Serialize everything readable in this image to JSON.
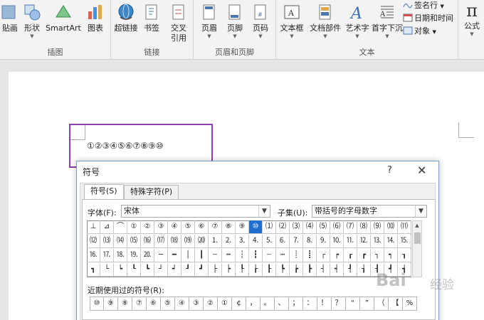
{
  "ribbon": {
    "groups": {
      "illustrations": {
        "label": "插图",
        "buttons": [
          "贴画",
          "形状",
          "SmartArt",
          "图表"
        ]
      },
      "links": {
        "label": "链接",
        "buttons": [
          "超链接",
          "书签",
          "交叉",
          "引用"
        ]
      },
      "header_footer": {
        "label": "页眉和页脚",
        "buttons": [
          "页眉",
          "页脚",
          "页码"
        ]
      },
      "text": {
        "label": "文本",
        "buttons": [
          "文本框",
          "文档部件",
          "艺术字",
          "首字下沉"
        ],
        "small": [
          "签名行",
          "日期和时间",
          "对象"
        ]
      },
      "symbols": {
        "buttons": [
          "公式"
        ],
        "pi": "π"
      }
    }
  },
  "document": {
    "text": "①②③④⑤⑥⑦⑧⑨⑩"
  },
  "dialog": {
    "title": "符号",
    "help": "?",
    "close": "✕",
    "tabs": [
      "符号(S)",
      "特殊字符(P)"
    ],
    "font_label": "字体(F):",
    "font_value": "宋体",
    "subset_label": "子集(U):",
    "subset_value": "带括号的字母数字",
    "symbol_rows": [
      [
        "⊥",
        "⊿",
        "⌒",
        "①",
        "②",
        "③",
        "④",
        "⑤",
        "⑥",
        "⑦",
        "⑧",
        "⑨",
        "⑩",
        "⑴",
        "⑵",
        "⑶",
        "⑷",
        "⑸",
        "⑹",
        "⑺",
        "⑻",
        "⑼",
        "⑽",
        "⑾"
      ],
      [
        "⑿",
        "⒀",
        "⒁",
        "⒂",
        "⒃",
        "⒄",
        "⒅",
        "⒆",
        "⒇",
        "⒈",
        "⒉",
        "⒊",
        "⒋",
        "⒌",
        "⒍",
        "⒎",
        "⒏",
        "⒐",
        "⒑",
        "⒒",
        "⒓",
        "⒔",
        "⒕",
        "⒖"
      ],
      [
        "⒗",
        "⒘",
        "⒙",
        "⒚",
        "⒛",
        "─",
        "━",
        "│",
        "┃",
        "┄",
        "┅",
        "┆",
        "┇",
        "┈",
        "┉",
        "┊",
        "┋",
        "┌",
        "┍",
        "┎",
        "┏",
        "┐",
        "┑",
        "┒"
      ],
      [
        "┓",
        "└",
        "┕",
        "┖",
        "┗",
        "┘",
        "┙",
        "┚",
        "┛",
        "├",
        "┝",
        "┞",
        "┟",
        "┠",
        "┡",
        "┢",
        "┣",
        "┤",
        "┥",
        "┦",
        "┧",
        "┨",
        "┩",
        "┪"
      ]
    ],
    "selected_symbol": "⑩",
    "recent_label": "近期使用过的符号(R):",
    "recent_symbols": [
      "⑩",
      "⑨",
      "⑧",
      "⑦",
      "⑥",
      "⑤",
      "④",
      "③",
      "②",
      "①",
      "¢",
      "，",
      "。",
      "、",
      "；",
      "：",
      "！",
      "？",
      "“",
      "”",
      "（",
      "【",
      "%"
    ]
  },
  "watermark": {
    "text": "Bai",
    "sub": "经验"
  },
  "colors": {
    "highlight": "#8b3fb2",
    "selection": "#1e6fd0"
  }
}
